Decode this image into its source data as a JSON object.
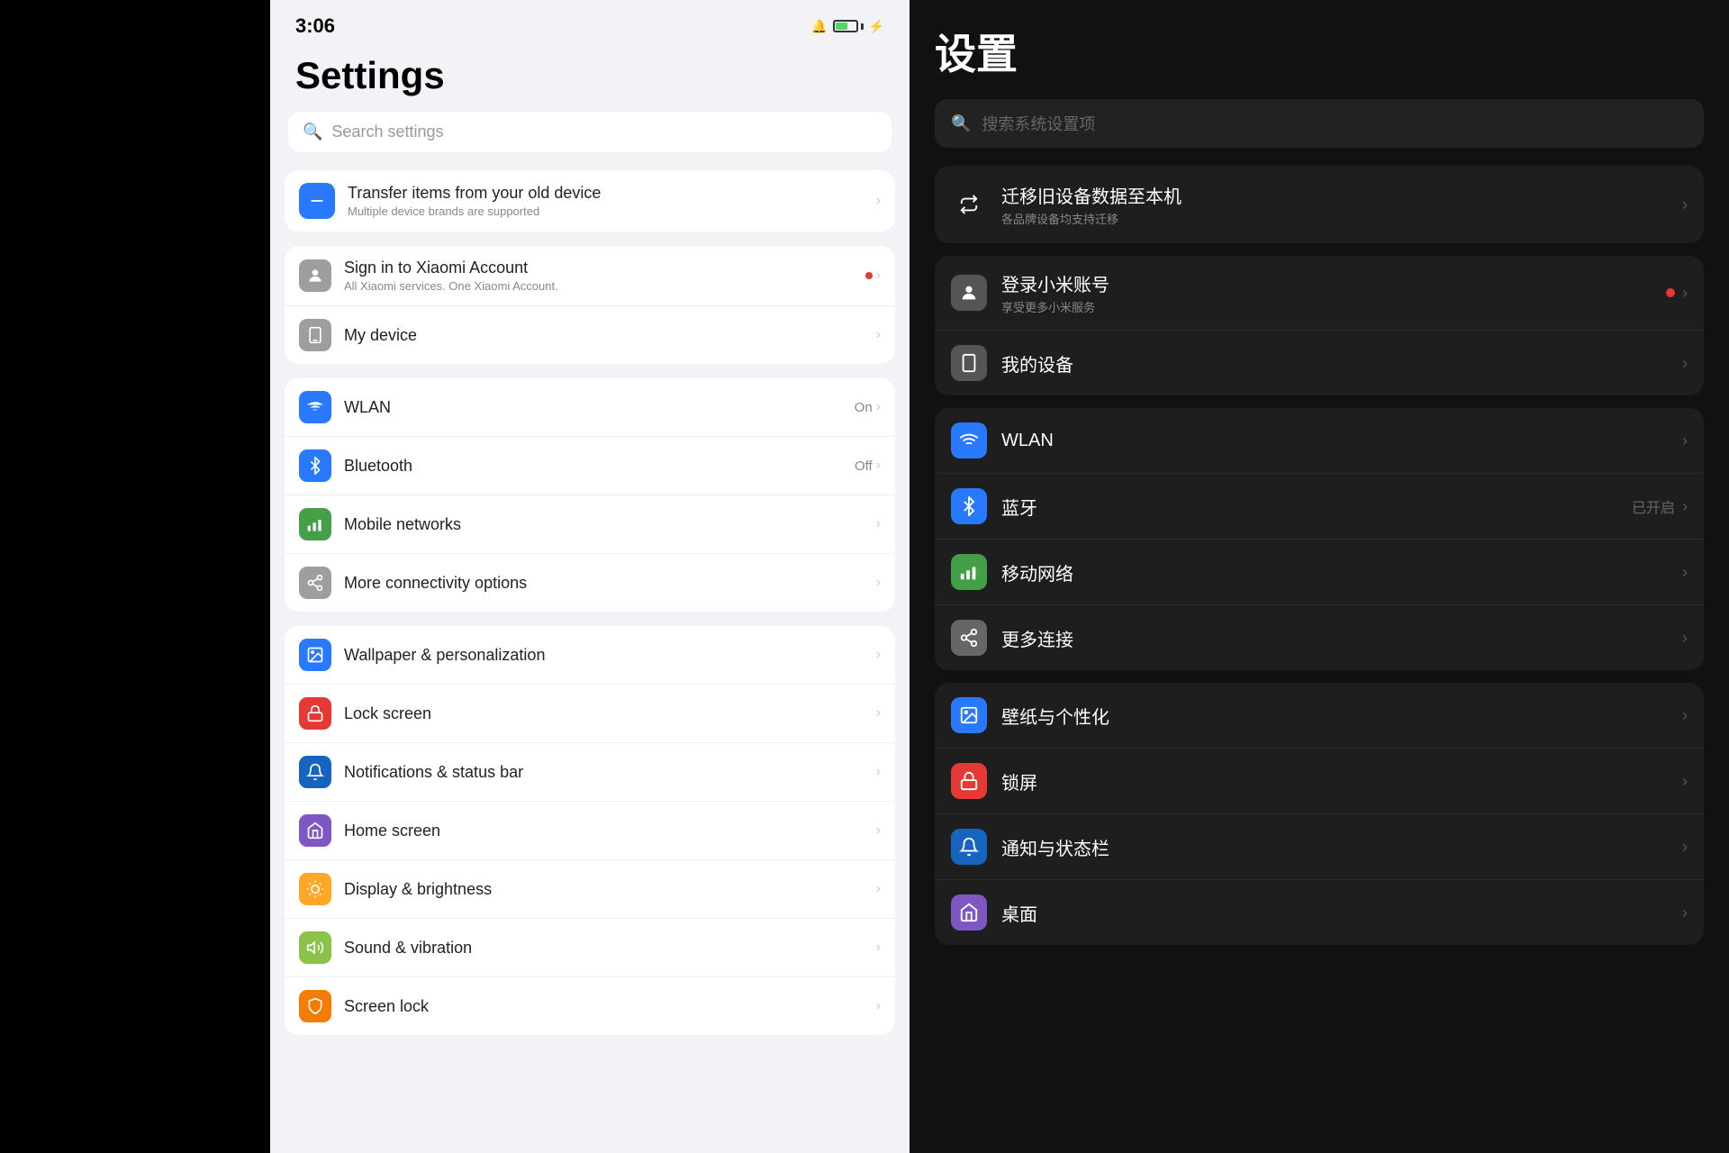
{
  "left": {},
  "phone": {
    "statusBar": {
      "time": "3:06",
      "batteryPercent": 60
    },
    "title": "Settings",
    "searchPlaceholder": "Search settings",
    "transferCard": {
      "title": "Transfer items from your old device",
      "subtitle": "Multiple device brands are supported"
    },
    "xiaomiAccount": {
      "title": "Sign in to Xiaomi Account",
      "subtitle": "All Xiaomi services. One Xiaomi Account.",
      "hasDot": true
    },
    "myDevice": {
      "title": "My device"
    },
    "connectivitySection": [
      {
        "id": "wlan",
        "title": "WLAN",
        "status": "On",
        "color": "blue",
        "icon": "wifi"
      },
      {
        "id": "bluetooth",
        "title": "Bluetooth",
        "status": "Off",
        "color": "blue",
        "icon": "bluetooth"
      },
      {
        "id": "mobile-networks",
        "title": "Mobile networks",
        "status": "",
        "color": "green",
        "icon": "bars"
      },
      {
        "id": "more-connectivity",
        "title": "More connectivity options",
        "status": "",
        "color": "gray",
        "icon": "share"
      }
    ],
    "personalizationSection": [
      {
        "id": "wallpaper",
        "title": "Wallpaper & personalization",
        "color": "blue",
        "icon": "palette"
      },
      {
        "id": "lock-screen",
        "title": "Lock screen",
        "color": "red",
        "icon": "lock"
      },
      {
        "id": "notifications",
        "title": "Notifications & status bar",
        "color": "dark-blue",
        "icon": "bell"
      },
      {
        "id": "home-screen",
        "title": "Home screen",
        "color": "purple",
        "icon": "home"
      },
      {
        "id": "display",
        "title": "Display & brightness",
        "color": "yellow",
        "icon": "sun"
      },
      {
        "id": "sound",
        "title": "Sound & vibration",
        "color": "lime",
        "icon": "music"
      },
      {
        "id": "screen-lock",
        "title": "Screen lock",
        "color": "orange",
        "icon": "shield"
      }
    ]
  },
  "right": {
    "title": "设置",
    "searchPlaceholder": "搜索系统设置项",
    "transferCard": {
      "title": "迁移旧设备数据至本机",
      "subtitle": "各品牌设备均支持迁移"
    },
    "xiaomiAccount": {
      "title": "登录小米账号",
      "subtitle": "享受更多小米服务",
      "hasDot": true
    },
    "myDevice": {
      "title": "我的设备"
    },
    "connectivitySection": [
      {
        "id": "wlan",
        "title": "WLAN",
        "status": "",
        "color": "blue",
        "icon": "wifi"
      },
      {
        "id": "bluetooth",
        "title": "蓝牙",
        "status": "已开启",
        "color": "blue",
        "icon": "bluetooth"
      },
      {
        "id": "mobile-networks",
        "title": "移动网络",
        "status": "",
        "color": "green",
        "icon": "bars"
      },
      {
        "id": "more-connectivity",
        "title": "更多连接",
        "status": "",
        "color": "gray",
        "icon": "share"
      }
    ],
    "personalizationSection": [
      {
        "id": "wallpaper",
        "title": "壁纸与个性化",
        "color": "blue",
        "icon": "palette"
      },
      {
        "id": "lock-screen",
        "title": "锁屏",
        "color": "red",
        "icon": "lock"
      },
      {
        "id": "notifications",
        "title": "通知与状态栏",
        "color": "dark-blue",
        "icon": "bell"
      },
      {
        "id": "home-screen",
        "title": "桌面",
        "color": "purple",
        "icon": "home"
      }
    ]
  }
}
